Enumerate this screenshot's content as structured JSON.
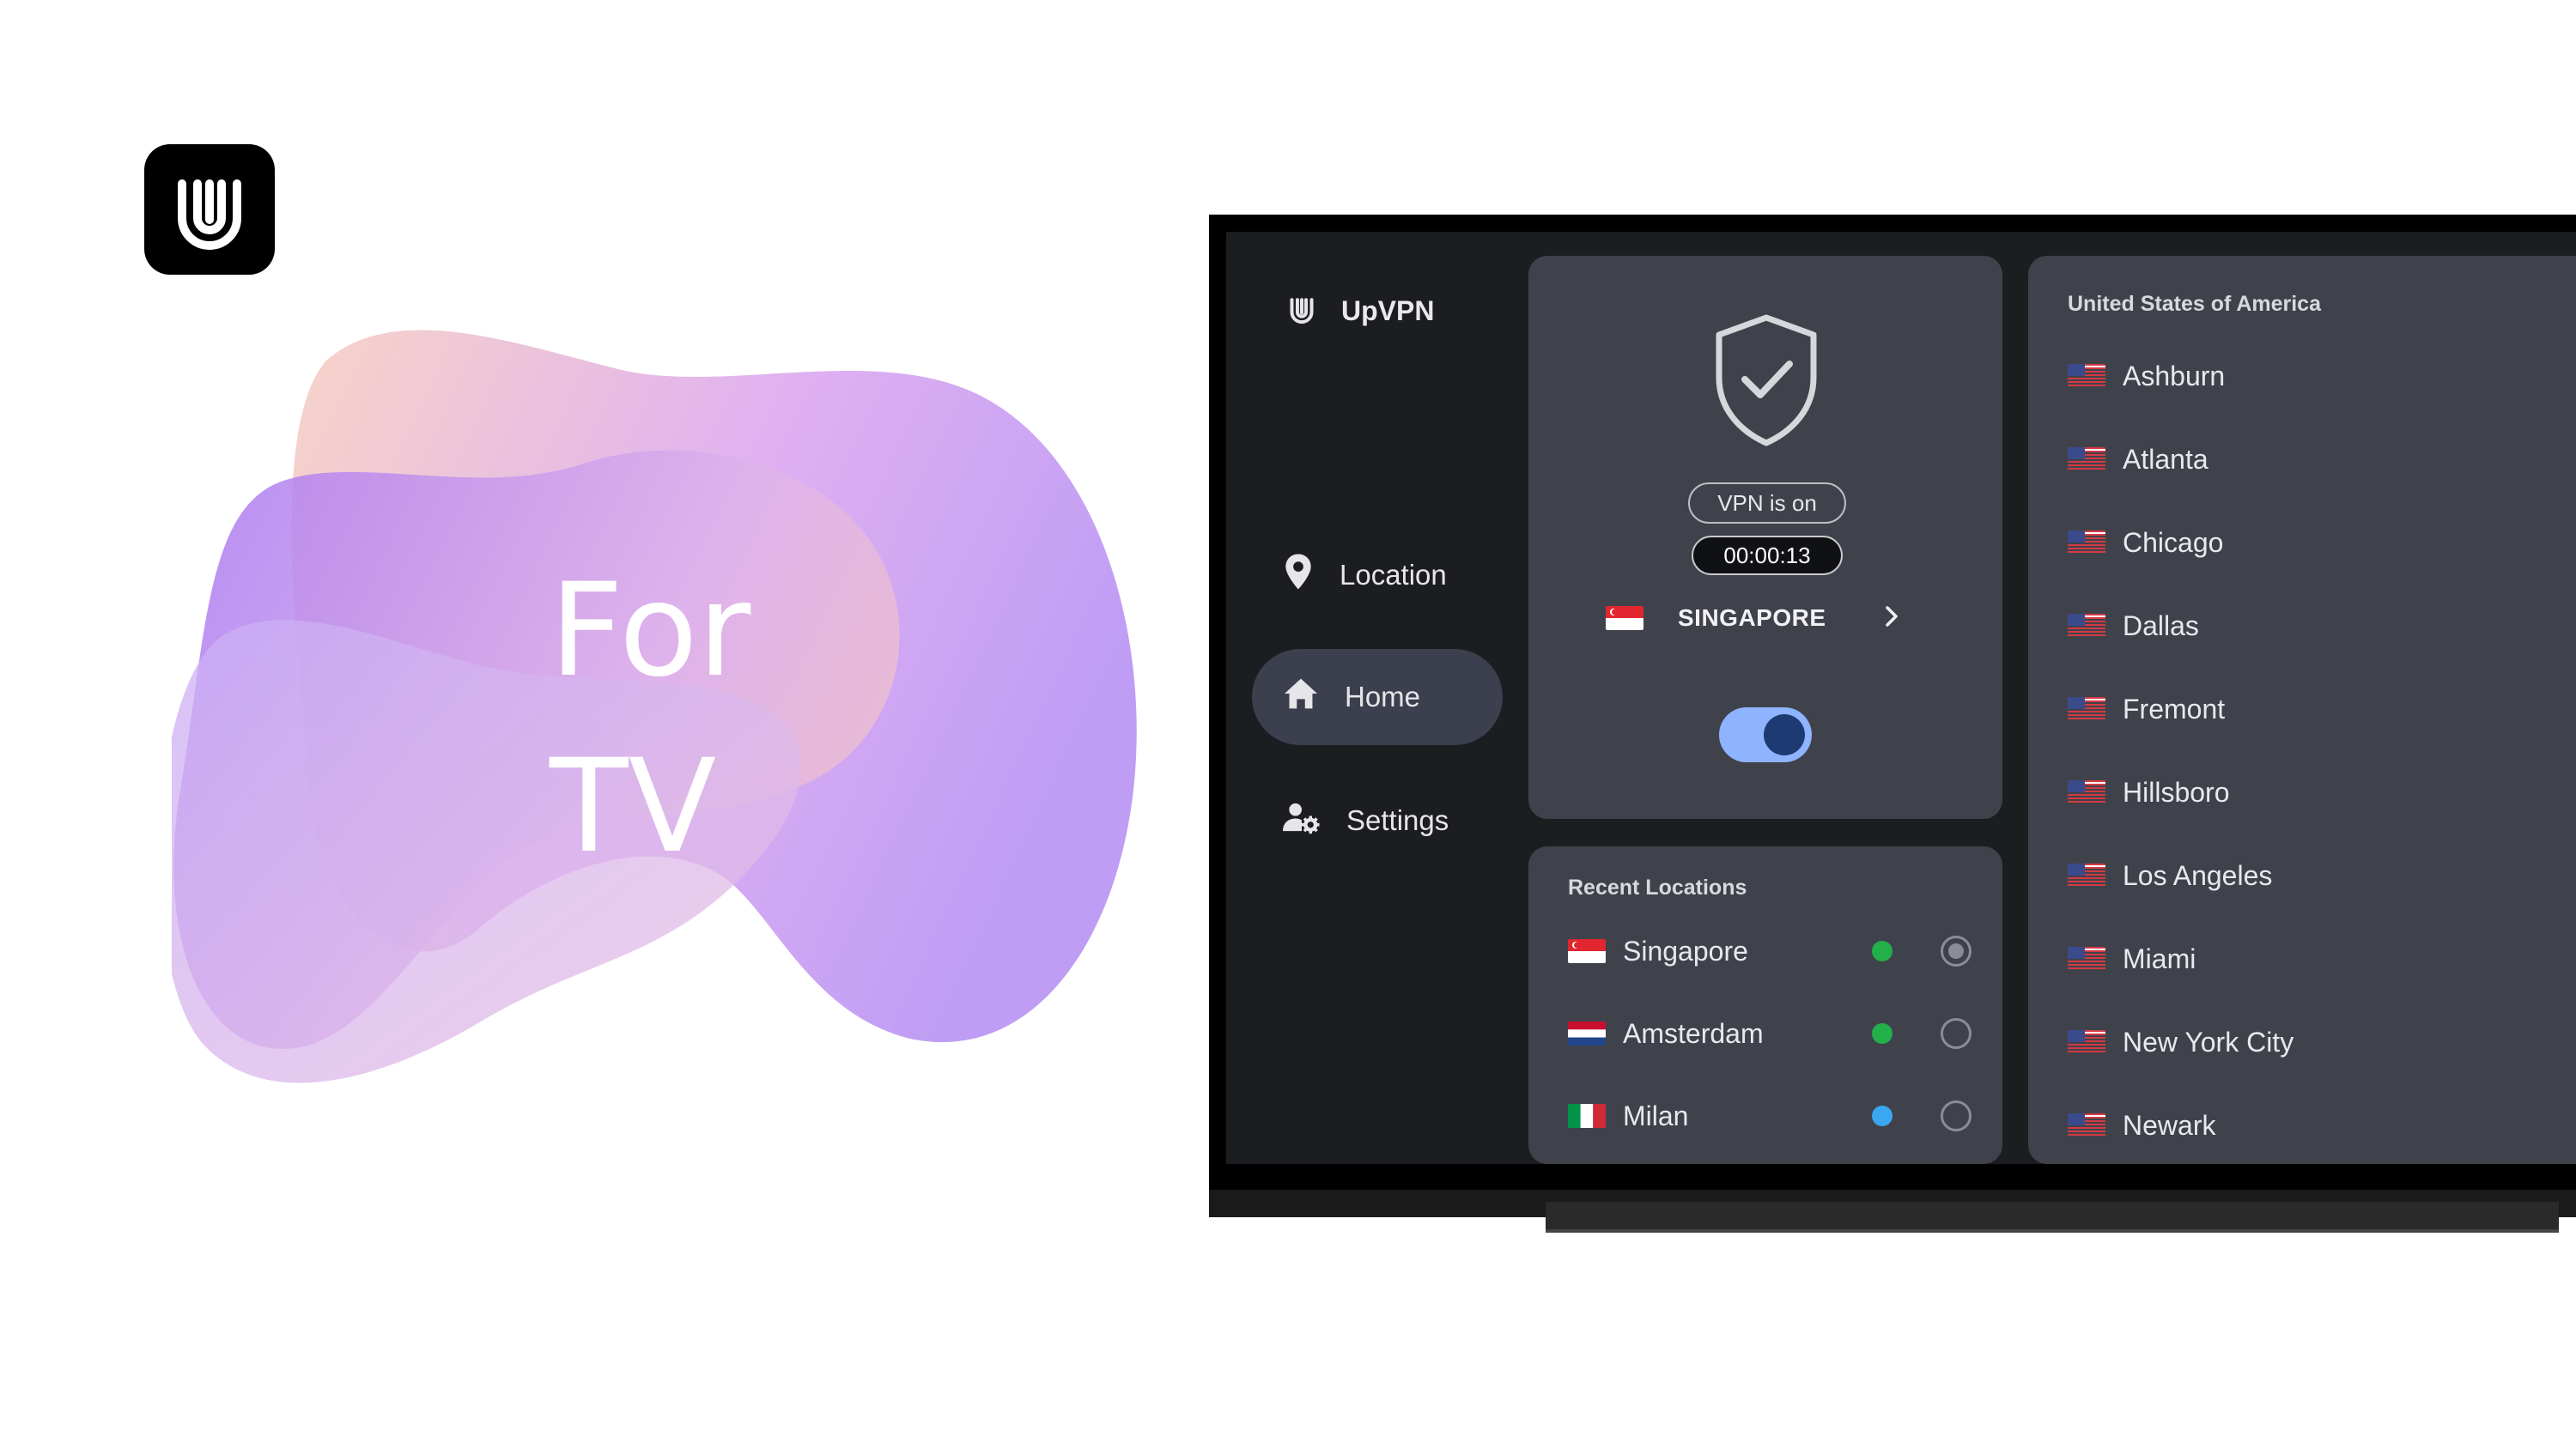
{
  "promo": {
    "line1": "For",
    "line2": "TV",
    "logo_icon": "upvpn-logo-icon"
  },
  "app": {
    "brand": "UpVPN"
  },
  "sidebar": {
    "items": [
      {
        "label": "Location",
        "icon": "location-pin-icon",
        "active": false
      },
      {
        "label": "Home",
        "icon": "home-icon",
        "active": true
      },
      {
        "label": "Settings",
        "icon": "user-settings-icon",
        "active": false
      }
    ]
  },
  "status": {
    "shield_icon": "shield-check-icon",
    "state_label": "VPN is on",
    "timer": "00:00:13",
    "server": "SINGAPORE",
    "toggle_on": true
  },
  "recent": {
    "title": "Recent Locations",
    "items": [
      {
        "name": "Singapore",
        "flag": "singapore",
        "status_color": "#22b04b",
        "selected": true
      },
      {
        "name": "Amsterdam",
        "flag": "netherlands",
        "status_color": "#22b04b",
        "selected": false
      },
      {
        "name": "Milan",
        "flag": "italy",
        "status_color": "#3aa8f0",
        "selected": false
      }
    ]
  },
  "locations": {
    "country": "United States of America",
    "cities": [
      "Ashburn",
      "Atlanta",
      "Chicago",
      "Dallas",
      "Fremont",
      "Hillsboro",
      "Los Angeles",
      "Miami",
      "New York City",
      "Newark"
    ]
  },
  "colors": {
    "screen_bg": "#1c1d21",
    "panel_bg": "#40424b",
    "active_nav": "#3c3f4d",
    "toggle_track": "#8fb4ff",
    "toggle_knob": "#1e3a73"
  }
}
